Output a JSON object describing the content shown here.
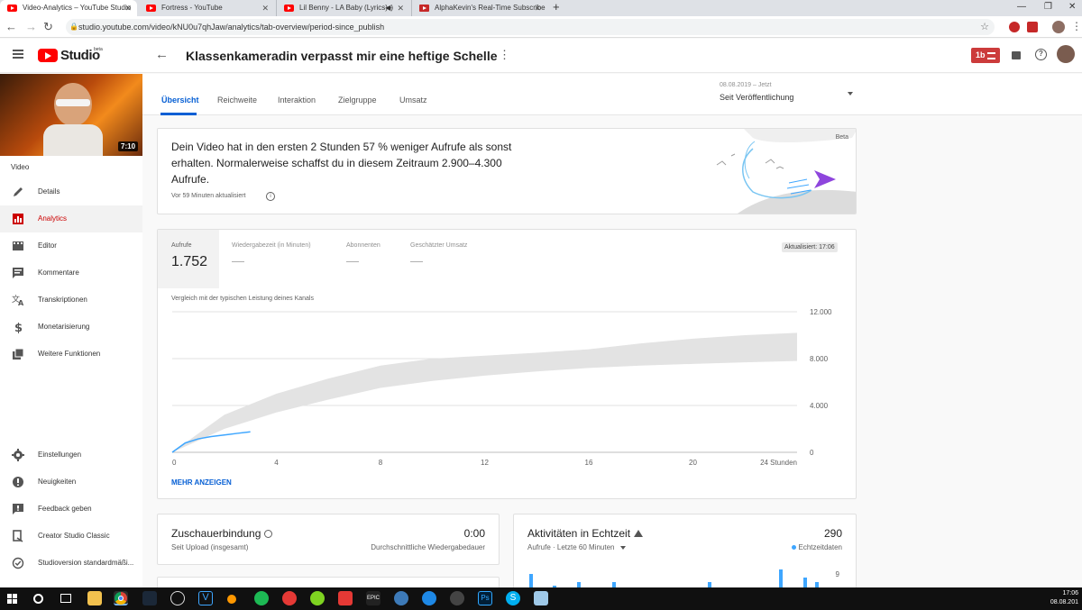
{
  "browser": {
    "tabs": [
      {
        "title": "Video-Analytics – YouTube Studio",
        "active": true
      },
      {
        "title": "Fortress - YouTube",
        "active": false
      },
      {
        "title": "Lil Benny - LA Baby (Lyrics) -",
        "active": false
      },
      {
        "title": "AlphaKevin's Real-Time Subscribe",
        "active": false
      }
    ],
    "new_tab": "+",
    "url": "studio.youtube.com/video/kNU0u7qhJaw/analytics/tab-overview/period-since_publish"
  },
  "header": {
    "logo_text": "Studio",
    "logo_badge": "beta",
    "video_title": "Klassenkameradin verpasst mir eine heftige Schelle"
  },
  "sidebar": {
    "duration": "7:10",
    "section_label": "Video",
    "items": [
      {
        "label": "Details",
        "icon": "pencil-icon"
      },
      {
        "label": "Analytics",
        "icon": "analytics-icon"
      },
      {
        "label": "Editor",
        "icon": "film-icon"
      },
      {
        "label": "Kommentare",
        "icon": "comment-icon"
      },
      {
        "label": "Transkriptionen",
        "icon": "translate-icon"
      },
      {
        "label": "Monetarisierung",
        "icon": "dollar-icon"
      },
      {
        "label": "Weitere Funktionen",
        "icon": "more-features-icon"
      }
    ],
    "bottom_items": [
      {
        "label": "Einstellungen",
        "icon": "gear-icon"
      },
      {
        "label": "Neuigkeiten",
        "icon": "alert-icon"
      },
      {
        "label": "Feedback geben",
        "icon": "feedback-icon"
      },
      {
        "label": "Creator Studio Classic",
        "icon": "classic-icon"
      },
      {
        "label": "Studioversion standardmäßi...",
        "icon": "check-circle-icon"
      }
    ]
  },
  "tabs": [
    "Übersicht",
    "Reichweite",
    "Interaktion",
    "Zielgruppe",
    "Umsatz"
  ],
  "period": {
    "range": "08.08.2019 – Jetzt",
    "label": "Seit Veröffentlichung"
  },
  "insight": {
    "text": "Dein Video hat in den ersten 2 Stunden 57 % weniger Aufrufe als sonst erhalten. Normalerweise schaffst du in diesem Zeitraum 2.900–4.300 Aufrufe.",
    "updated": "Vor 59 Minuten aktualisiert",
    "badge": "Beta"
  },
  "metrics": [
    {
      "label": "Aufrufe",
      "value": "1.752"
    },
    {
      "label": "Wiedergabezeit (in Minuten)",
      "value": "—"
    },
    {
      "label": "Abonnenten",
      "value": "—"
    },
    {
      "label": "Geschätzter Umsatz",
      "value": "—"
    }
  ],
  "updated_badge": "Aktualisiert: 17:06",
  "chart_caption": "Vergleich mit der typischen Leistung deines Kanals",
  "more_button": "MEHR ANZEIGEN",
  "chart_data": {
    "type": "line",
    "x_tick_labels": [
      "0",
      "4",
      "8",
      "12",
      "16",
      "20",
      "24 Stunden"
    ],
    "y_tick_labels": [
      "12.000",
      "8.000",
      "4.000",
      "0"
    ],
    "xlim": [
      0,
      24
    ],
    "ylim": [
      0,
      12000
    ],
    "grid": true,
    "typical_band": {
      "x": [
        0,
        2,
        4,
        6,
        8,
        10,
        12,
        14,
        16,
        18,
        20,
        22,
        24
      ],
      "low": [
        0,
        2000,
        3400,
        4500,
        5500,
        6100,
        6550,
        6900,
        7200,
        7400,
        7550,
        7680,
        7800
      ],
      "high": [
        0,
        3200,
        5000,
        6300,
        7400,
        8000,
        8250,
        8500,
        8800,
        9300,
        9700,
        10000,
        10200
      ]
    },
    "series": [
      {
        "x": [
          0,
          0.5,
          1,
          1.5,
          2,
          2.5,
          3
        ],
        "values": [
          0,
          800,
          1150,
          1350,
          1480,
          1620,
          1752
        ],
        "color": "#3ea6ff"
      }
    ]
  },
  "engagement": {
    "title": "Zuschauerbindung",
    "subtitle": "Seit Upload (insgesamt)",
    "value": "0:00",
    "value_label": "Durchschnittliche Wiedergabedauer"
  },
  "realtime": {
    "title": "Aktivitäten in Echtzeit",
    "value": "290",
    "subtitle": "Aufrufe · Letzte 60 Minuten",
    "legend": "Echtzeitdaten",
    "axis_max": "9",
    "bars": [
      5,
      0,
      2,
      0,
      3,
      0,
      0,
      3,
      0,
      0,
      0,
      0,
      0,
      0,
      0,
      3,
      0,
      0,
      0,
      0,
      0,
      6,
      0,
      4,
      3
    ]
  },
  "taskbar": {
    "time": "17:06",
    "date": "08.08.201"
  }
}
